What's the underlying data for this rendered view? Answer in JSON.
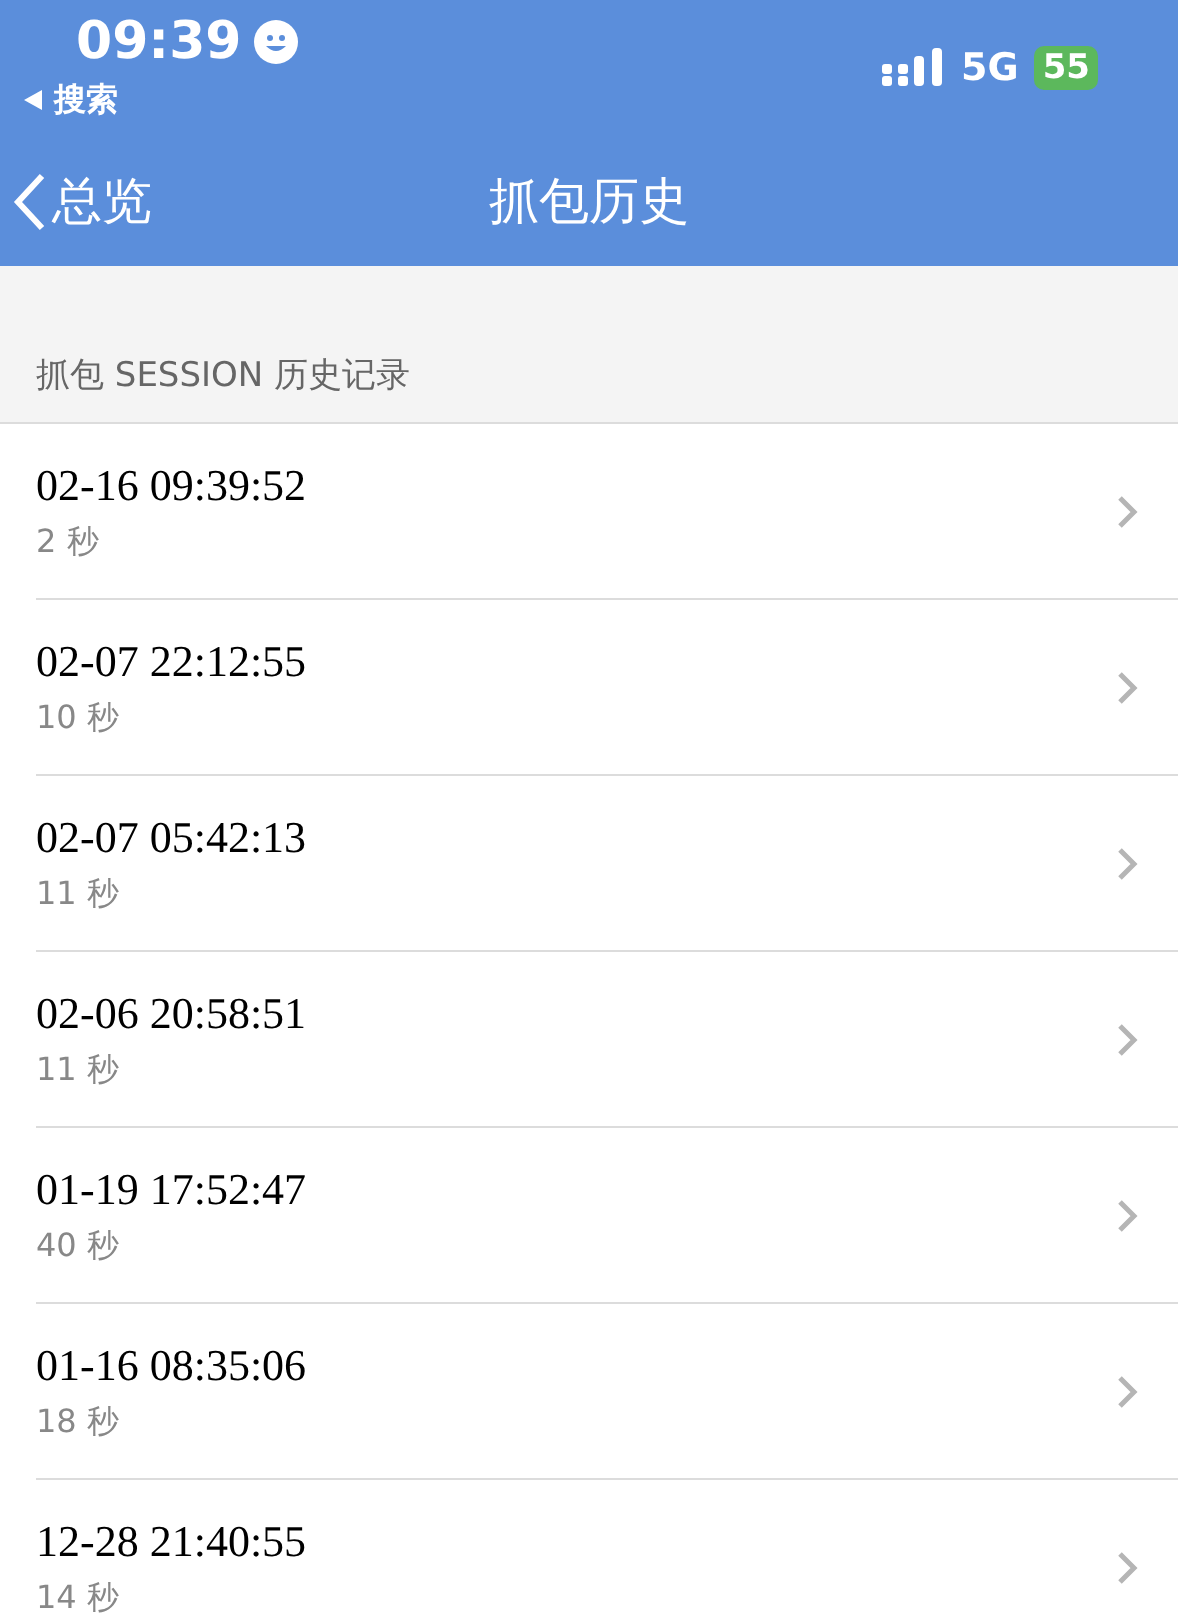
{
  "status_bar": {
    "time": "09:39",
    "back_app": "搜索",
    "network": "5G",
    "battery": "55"
  },
  "nav": {
    "back": "总览",
    "title": "抓包历史"
  },
  "section_header": "抓包 SESSION 历史记录",
  "sessions": [
    {
      "date": "02-16 09:39:52",
      "duration": "2 秒"
    },
    {
      "date": "02-07 22:12:55",
      "duration": "10 秒"
    },
    {
      "date": "02-07 05:42:13",
      "duration": "11 秒"
    },
    {
      "date": "02-06 20:58:51",
      "duration": "11 秒"
    },
    {
      "date": "01-19 17:52:47",
      "duration": "40 秒"
    },
    {
      "date": "01-16 08:35:06",
      "duration": "18 秒"
    },
    {
      "date": "12-28 21:40:55",
      "duration": "14 秒"
    }
  ]
}
